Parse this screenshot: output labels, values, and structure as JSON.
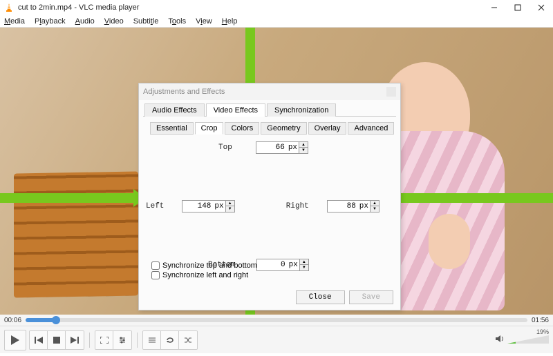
{
  "window": {
    "title": "cut to 2min.mp4 - VLC media player"
  },
  "menu": {
    "media": "Media",
    "playback": "Playback",
    "audio": "Audio",
    "video": "Video",
    "subtitle": "Subtitle",
    "tools": "Tools",
    "view": "View",
    "help": "Help"
  },
  "dialog": {
    "title": "Adjustments and Effects",
    "tabs": {
      "audio": "Audio Effects",
      "video": "Video Effects",
      "sync": "Synchronization"
    },
    "subtabs": {
      "essential": "Essential",
      "crop": "Crop",
      "colors": "Colors",
      "geometry": "Geometry",
      "overlay": "Overlay",
      "advanced": "Advanced"
    },
    "crop": {
      "top_label": "Top",
      "top_value": "66",
      "left_label": "Left",
      "left_value": "148",
      "right_label": "Right",
      "right_value": "88",
      "bottom_label": "Bottom",
      "bottom_value": "0",
      "unit": "px",
      "sync_tb": "Synchronize top and bottom",
      "sync_lr": "Synchronize left and right"
    },
    "buttons": {
      "close": "Close",
      "save": "Save"
    }
  },
  "player": {
    "time_current": "00:06",
    "time_total": "01:56",
    "volume": "19%"
  }
}
